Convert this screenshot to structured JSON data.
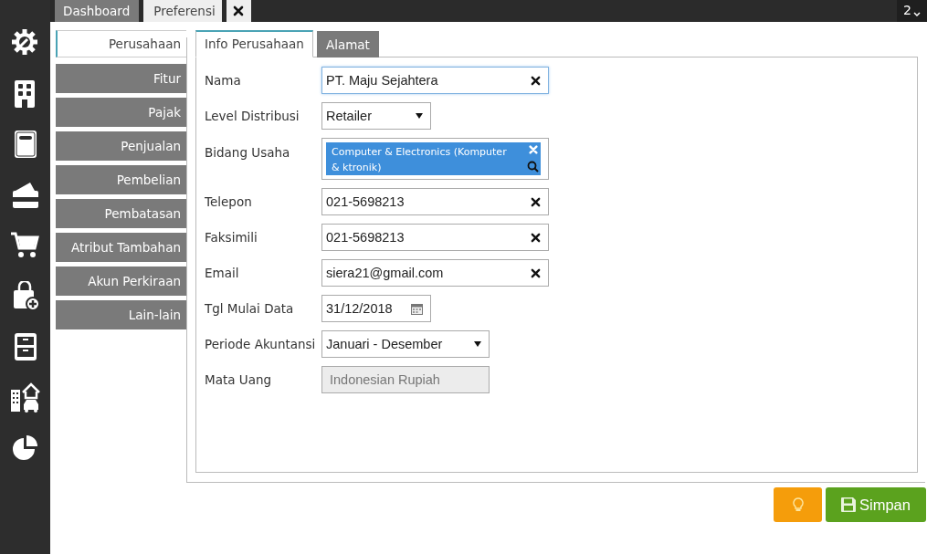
{
  "top_tabs": [
    {
      "label": "Dashboard",
      "selected": false
    },
    {
      "label": "Preferensi",
      "selected": true
    }
  ],
  "window_counter": "2",
  "nav": [
    {
      "label": "Perusahaan",
      "selected": true
    },
    {
      "label": "Fitur",
      "selected": false
    },
    {
      "label": "Pajak",
      "selected": false
    },
    {
      "label": "Penjualan",
      "selected": false
    },
    {
      "label": "Pembelian",
      "selected": false
    },
    {
      "label": "Pembatasan",
      "selected": false
    },
    {
      "label": "Atribut Tambahan",
      "selected": false
    },
    {
      "label": "Akun Perkiraan",
      "selected": false
    },
    {
      "label": "Lain-lain",
      "selected": false
    }
  ],
  "form_tabs": [
    {
      "label": "Info Perusahaan",
      "selected": true
    },
    {
      "label": "Alamat",
      "selected": false
    }
  ],
  "fields": [
    {
      "label": "Nama",
      "kind": "text",
      "value": "PT. Maju Sejahtera",
      "focused": true
    },
    {
      "label": "Level Distribusi",
      "kind": "select",
      "value": "Retailer"
    },
    {
      "label": "Bidang Usaha",
      "kind": "tags",
      "tags": [
        "Computer & Electronics (Komputer & ktronik)"
      ]
    },
    {
      "label": "Telepon",
      "kind": "text",
      "value": "021-5698213",
      "focused": false
    },
    {
      "label": "Faksimili",
      "kind": "text",
      "value": "021-5698213",
      "focused": false
    },
    {
      "label": "Email",
      "kind": "text",
      "value": "siera21@gmail.com",
      "focused": false
    },
    {
      "label": "Tgl Mulai Data",
      "kind": "date",
      "value": "31/12/2018"
    },
    {
      "label": "Periode Akuntansi",
      "kind": "select-wide",
      "value": "Januari - Desember"
    },
    {
      "label": "Mata Uang",
      "kind": "readonly",
      "value": "Indonesian Rupiah"
    }
  ],
  "buttons": [
    {
      "kind": "hint"
    },
    {
      "kind": "save",
      "label": "Simpan"
    }
  ]
}
